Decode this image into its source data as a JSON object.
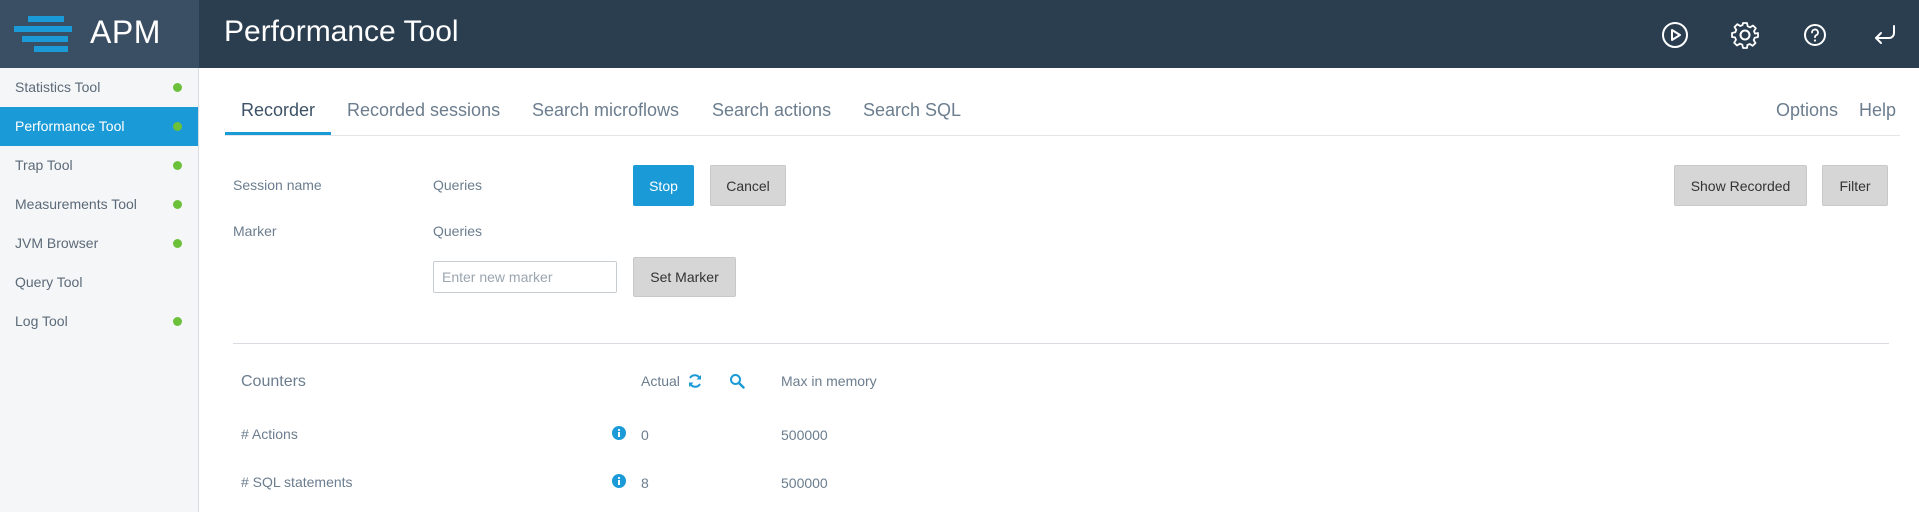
{
  "app": {
    "logo_text": "APM",
    "page_title": "Performance Tool"
  },
  "header_icons": [
    "play-circle-icon",
    "gear-icon",
    "help-circle-icon",
    "return-icon"
  ],
  "sidebar": {
    "items": [
      {
        "label": "Statistics Tool",
        "status": "green"
      },
      {
        "label": "Performance Tool",
        "status": "green",
        "active": true
      },
      {
        "label": "Trap Tool",
        "status": "green"
      },
      {
        "label": "Measurements Tool",
        "status": "green"
      },
      {
        "label": "JVM Browser",
        "status": "green"
      },
      {
        "label": "Query Tool",
        "status": "none"
      },
      {
        "label": "Log Tool",
        "status": "green"
      }
    ]
  },
  "tabs": [
    "Recorder",
    "Recorded sessions",
    "Search microflows",
    "Search actions",
    "Search SQL"
  ],
  "tabs_right": [
    "Options",
    "Help"
  ],
  "recorder": {
    "session_name_label": "Session name",
    "session_name_value": "Queries",
    "marker_label": "Marker",
    "marker_value": "Queries",
    "marker_placeholder": "Enter new marker",
    "stop_label": "Stop",
    "cancel_label": "Cancel",
    "set_marker_label": "Set Marker",
    "show_recorded_label": "Show Recorded",
    "filter_label": "Filter"
  },
  "counters": {
    "title": "Counters",
    "col_actual": "Actual",
    "col_max": "Max in memory",
    "rows": [
      {
        "label": "# Actions",
        "actual": "0",
        "max": "500000"
      },
      {
        "label": "# SQL statements",
        "actual": "8",
        "max": "500000"
      }
    ]
  },
  "colors": {
    "header": "#2b3e50",
    "accent": "#1a9ad6",
    "status_green": "#6cc03a"
  }
}
